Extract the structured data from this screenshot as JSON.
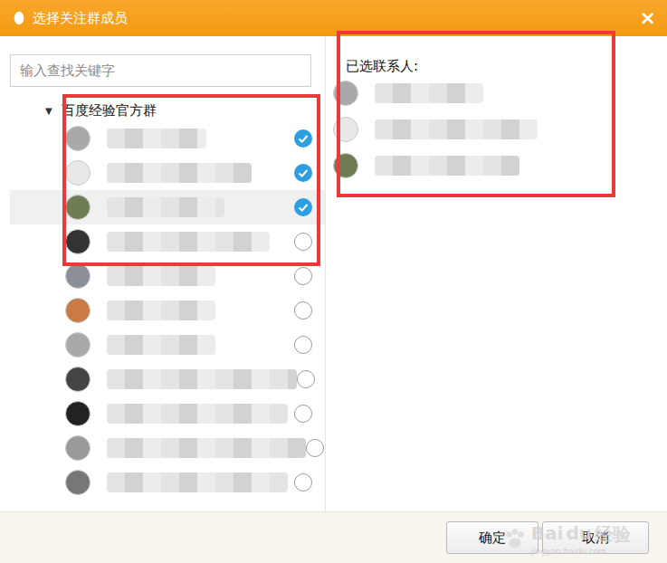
{
  "window": {
    "title": "选择关注群成员",
    "close": "×"
  },
  "search": {
    "placeholder": "输入查找关键字"
  },
  "group": {
    "name": "百度经验官方群",
    "toggle": "▼",
    "expanded": true,
    "members": [
      {
        "selected": true,
        "hovered": false
      },
      {
        "selected": true,
        "hovered": false
      },
      {
        "selected": true,
        "hovered": true
      },
      {
        "selected": false,
        "hovered": false
      },
      {
        "selected": false,
        "hovered": false
      },
      {
        "selected": false,
        "hovered": false
      },
      {
        "selected": false,
        "hovered": false
      },
      {
        "selected": false,
        "hovered": false
      },
      {
        "selected": false,
        "hovered": false
      },
      {
        "selected": false,
        "hovered": false
      },
      {
        "selected": false,
        "hovered": false
      }
    ]
  },
  "selected_panel": {
    "title": "已选联系人:"
  },
  "buttons": [
    "确定",
    "取消"
  ],
  "watermark": {
    "logo": [
      "Bai",
      "du",
      "经验"
    ],
    "url": "jingyan.baidu.com"
  }
}
